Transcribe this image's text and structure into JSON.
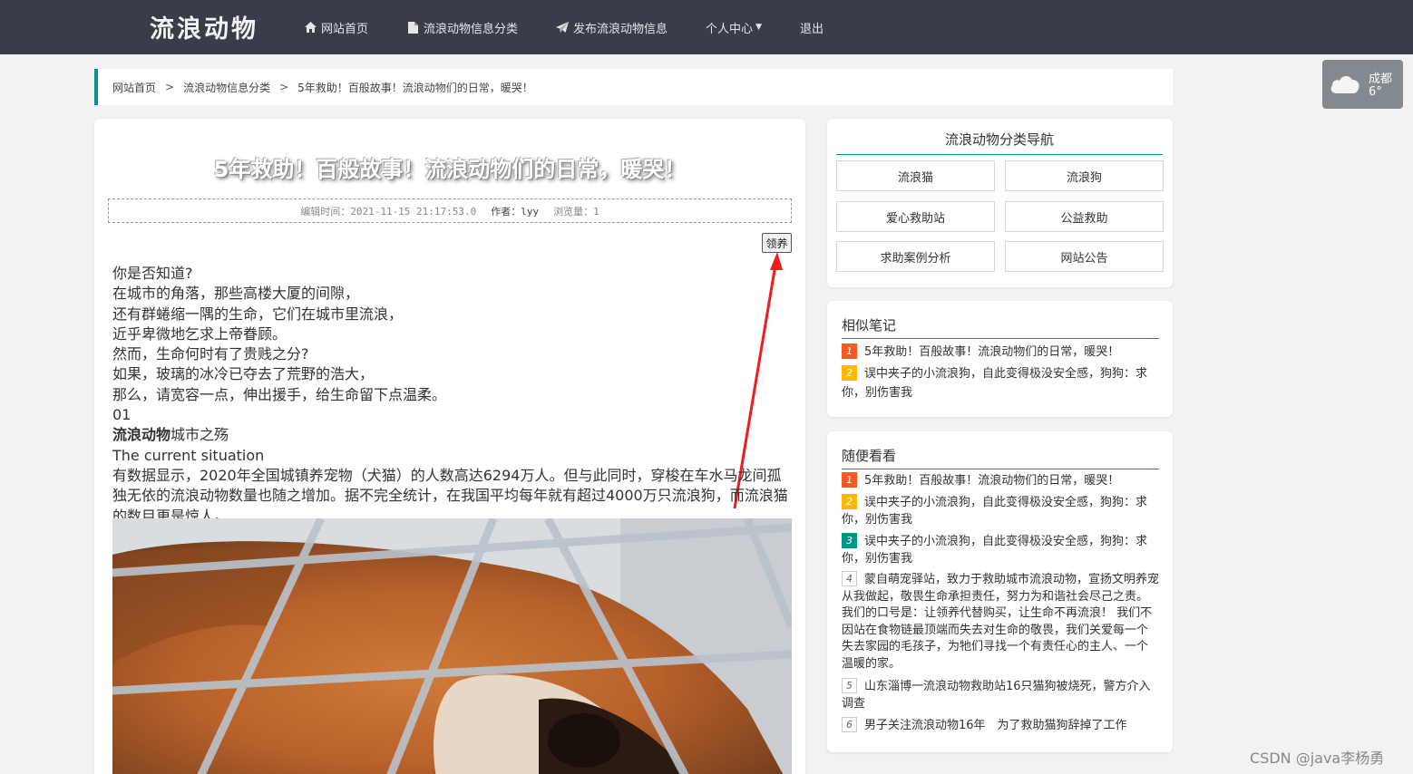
{
  "brand": "流浪动物",
  "nav": [
    {
      "label": "网站首页",
      "icon": "home-icon"
    },
    {
      "label": "流浪动物信息分类",
      "icon": "document-icon"
    },
    {
      "label": "发布流浪动物信息",
      "icon": "paper-plane-icon"
    },
    {
      "label": "个人中心",
      "icon": "caret-down-icon"
    },
    {
      "label": "退出"
    }
  ],
  "weather": {
    "city": "成都",
    "temp": "6°",
    "icon": "cloud-icon"
  },
  "breadcrumb": {
    "home": "网站首页",
    "category": "流浪动物信息分类",
    "current": "5年救助！百般故事！流浪动物们的日常，暖哭！",
    "sep": ">"
  },
  "article": {
    "title": "5年救助！百般故事！流浪动物们的日常，暖哭！",
    "edit_time": "编辑时间：2021-11-15 21:17:53.0",
    "author": "作者：lyy",
    "views": "浏览量：1",
    "adopt_label": "领养",
    "lines": [
      "你是否知道?",
      "在城市的角落，那些高楼大厦的间隙，",
      "还有群蜷缩一隅的生命，它们在城市里流浪，",
      "近乎卑微地乞求上帝眷顾。",
      "然而，生命何时有了贵贱之分?",
      "如果，玻璃的冰冷已夺去了荒野的浩大，",
      "那么，请宽容一点，伸出援手，给生命留下点温柔。",
      "01"
    ],
    "heading_bold": "流浪动物",
    "heading_rest": "城市之殇",
    "subheading": "The current situation",
    "paragraph": "有数据显示，2020年全国城镇养宠物（犬猫）的人数高达6294万人。但与此同时，穿梭在车水马龙间孤独无依的流浪动物数量也随之增加。据不完全统计，在我国平均每年就有超过4000万只流浪狗，而流浪猫的数目更是惊人。"
  },
  "category_nav": {
    "title": "流浪动物分类导航",
    "items": [
      "流浪猫",
      "流浪狗",
      "爱心救助站",
      "公益救助",
      "求助案例分析",
      "网站公告"
    ]
  },
  "similar": {
    "title": "相似笔记",
    "items": [
      {
        "num": "1",
        "text": "5年救助！百般故事！流浪动物们的日常，暖哭！"
      },
      {
        "num": "2",
        "text": "误中夹子的小流浪狗，自此变得极没安全感，狗狗：求你，别伤害我"
      }
    ]
  },
  "random": {
    "title": "随便看看",
    "items": [
      {
        "num": "1",
        "text": "5年救助！百般故事！流浪动物们的日常，暖哭！"
      },
      {
        "num": "2",
        "text": "误中夹子的小流浪狗，自此变得极没安全感，狗狗：求你，别伤害我"
      },
      {
        "num": "3",
        "text": "误中夹子的小流浪狗，自此变得极没安全感，狗狗：求你，别伤害我"
      },
      {
        "num": "4",
        "text": "蒙自萌宠驿站，致力于救助城市流浪动物，宣扬文明养宠从我做起，敬畏生命承担责任，努力为和谐社会尽己之责。 我们的口号是：让领养代替购买，让生命不再流浪！ 我们不因站在食物链最顶端而失去对生命的敬畏，我们关爱每一个失去家园的毛孩子，为牠们寻找一个有责任心的主人、一个温暖的家。"
      },
      {
        "num": "5",
        "text": "山东淄博一流浪动物救助站16只猫狗被烧死，警方介入调查"
      },
      {
        "num": "6",
        "text": "男子关注流浪动物16年　为了救助猫狗辞掉了工作"
      }
    ]
  },
  "watermark": "CSDN @java李杨勇"
}
